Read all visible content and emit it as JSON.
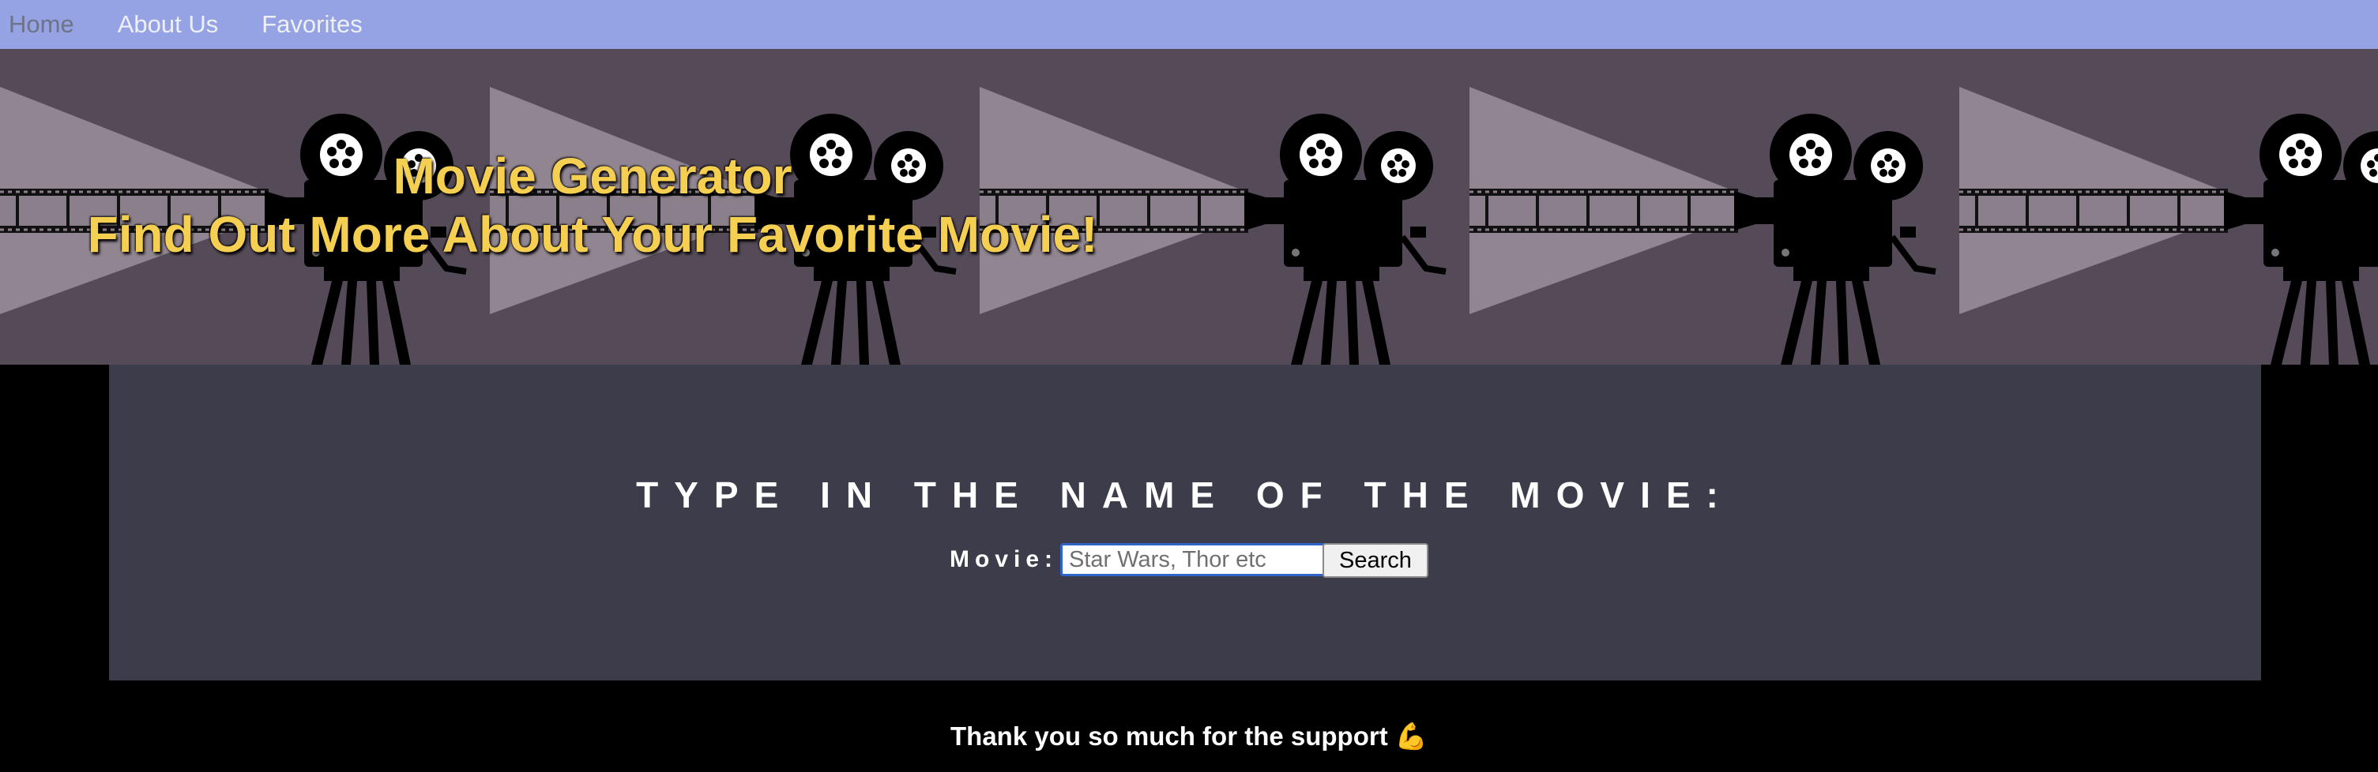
{
  "nav": {
    "items": [
      {
        "label": "Home"
      },
      {
        "label": "About Us"
      },
      {
        "label": "Favorites"
      }
    ]
  },
  "banner": {
    "title": "Movie Generator",
    "subtitle": "Find Out More About Your Favorite Movie!",
    "background_color": "#554a58",
    "title_color": "#f5cf52",
    "tile_icon": "movie-camera-projector-icon"
  },
  "search": {
    "heading": "TYPE IN THE NAME OF THE MOVIE:",
    "field_label": "Movie:",
    "placeholder": "Star Wars, Thor etc",
    "value": "",
    "button_label": "Search"
  },
  "footer": {
    "text": "Thank you so much for the support",
    "emoji": "💪"
  },
  "colors": {
    "nav_bg": "#95a2e3",
    "panel_bg": "#3c3c4b",
    "page_bg": "#000000"
  }
}
